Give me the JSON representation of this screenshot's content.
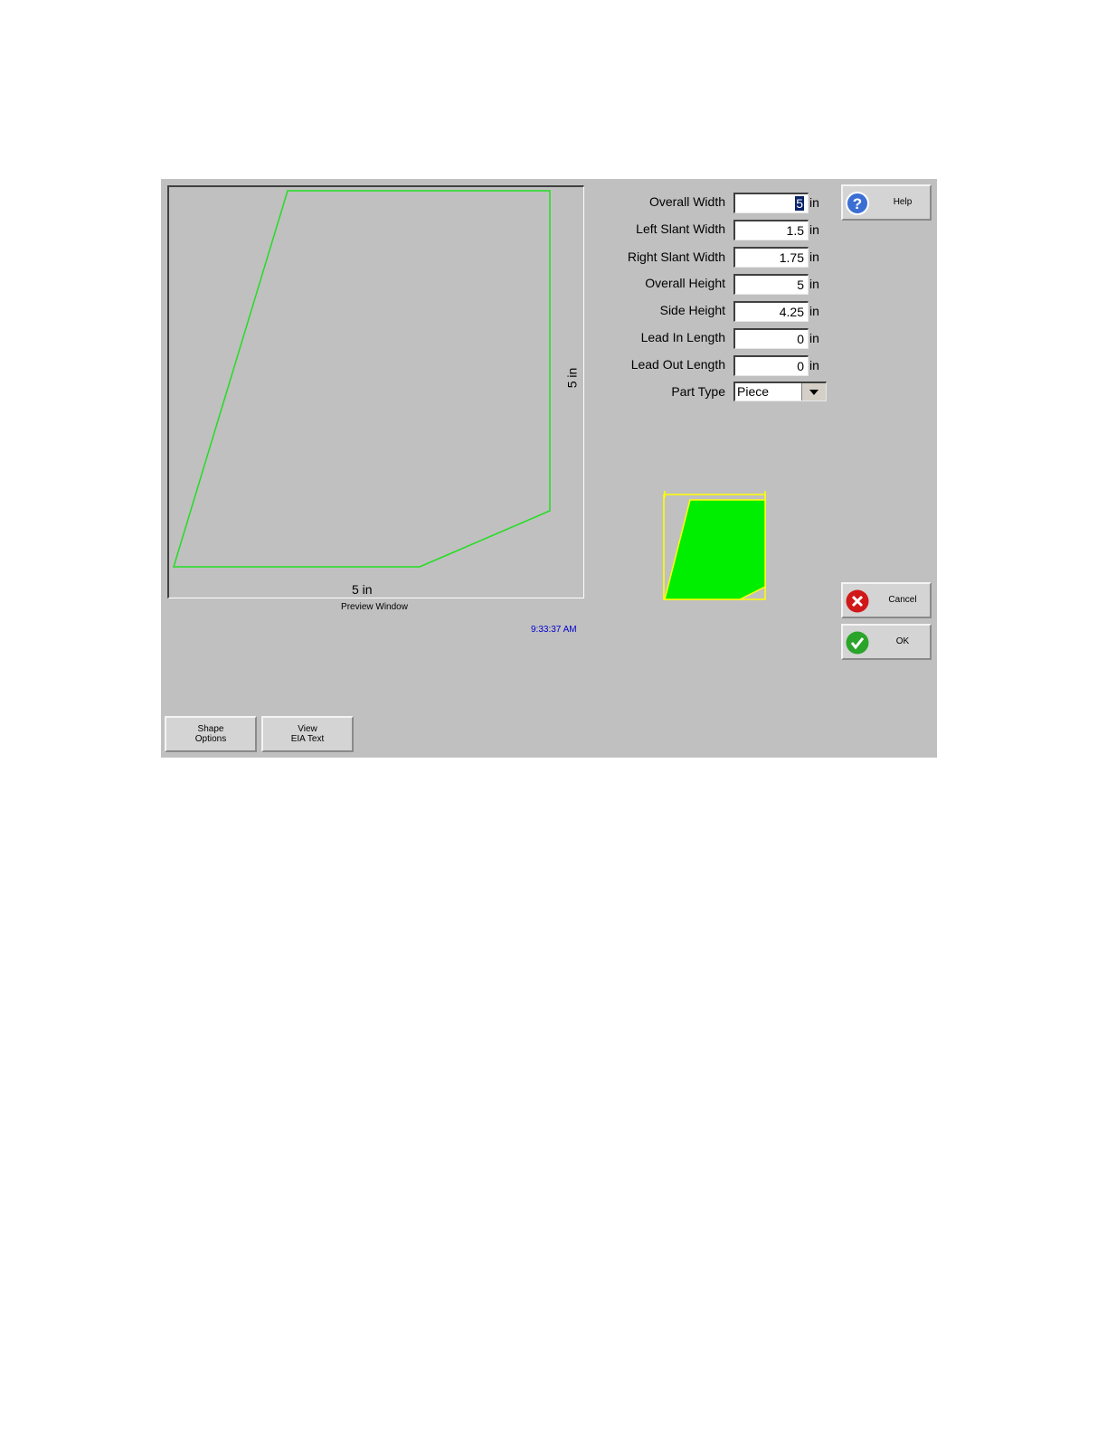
{
  "preview": {
    "caption": "Preview Window",
    "width_label": "5 in",
    "height_label": "5 in",
    "outline_color": "#22dd22"
  },
  "clock": "9:33:37 AM",
  "fields": [
    {
      "label": "Overall Width",
      "value": "5",
      "unit": "in"
    },
    {
      "label": "Left Slant Width",
      "value": "1.5",
      "unit": "in"
    },
    {
      "label": "Right Slant Width",
      "value": "1.75",
      "unit": "in"
    },
    {
      "label": "Overall Height",
      "value": "5",
      "unit": "in"
    },
    {
      "label": "Side Height",
      "value": "4.25",
      "unit": "in"
    },
    {
      "label": "Lead In Length",
      "value": "0",
      "unit": "in"
    },
    {
      "label": "Lead Out Length",
      "value": "0",
      "unit": "in"
    }
  ],
  "part_type": {
    "label": "Part Type",
    "value": "Piece"
  },
  "buttons": {
    "help": "Help",
    "cancel": "Cancel",
    "ok": "OK",
    "shape_options": [
      "Shape",
      "Options"
    ],
    "view_eia": [
      "View",
      "EIA Text"
    ]
  },
  "icons": {
    "help": "question-icon",
    "cancel": "close-icon",
    "ok": "check-icon",
    "dropdown": "chevron-down-icon"
  },
  "colors": {
    "panel": "#c0c0c0",
    "shape_fill": "#00ee00",
    "shape_border": "#ffff00",
    "clock": "#0000cc"
  }
}
